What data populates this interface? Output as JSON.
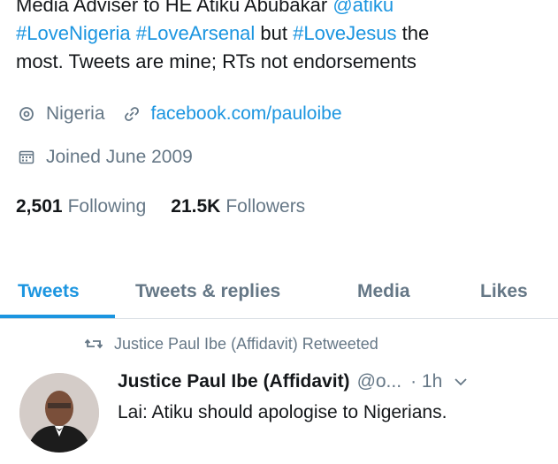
{
  "profile": {
    "bio_line1": "Media Adviser to HE Atiku Abubakar ",
    "bio_mention": "@atiku",
    "bio_tag1": "#LoveNigeria",
    "bio_tag2": "#LoveArsenal",
    "bio_but": " but ",
    "bio_tag3": "#LoveJesus",
    "bio_the": " the",
    "bio_line3": "most. Tweets are mine; RTs not endorsements",
    "location": "Nigeria",
    "website": "facebook.com/pauloibe",
    "joined": "Joined June 2009",
    "following_count": "2,501",
    "following_label": "Following",
    "followers_count": "21.5K",
    "followers_label": "Followers"
  },
  "tabs": [
    {
      "label": "Tweets",
      "active": true
    },
    {
      "label": "Tweets & replies",
      "active": false
    },
    {
      "label": "Media",
      "active": false
    },
    {
      "label": "Likes",
      "active": false
    }
  ],
  "tweet": {
    "retweet_text": "Justice Paul Ibe (Affidavit) Retweeted",
    "author_name": "Justice Paul Ibe (Affidavit)",
    "handle": "@o...",
    "time": "· 1h",
    "text": "Lai: Atiku should apologise to Nigerians."
  },
  "colors": {
    "accent": "#1b95e0",
    "muted": "#657786",
    "text": "#14171a"
  },
  "icons": [
    "location-pin-icon",
    "link-icon",
    "calendar-icon",
    "retweet-icon",
    "chevron-down-icon"
  ]
}
